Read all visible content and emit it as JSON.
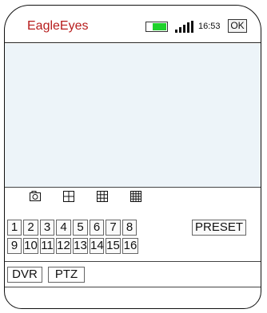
{
  "app": {
    "title": "EagleEyes"
  },
  "status": {
    "time": "16:53",
    "ok_label": "OK",
    "battery_level": 0.65,
    "battery_color": "#1fd12b",
    "title_color": "#b71c1c"
  },
  "layouts": [
    {
      "name": "snapshot-icon"
    },
    {
      "name": "quad-view-icon"
    },
    {
      "name": "nine-view-icon"
    },
    {
      "name": "sixteen-view-icon"
    }
  ],
  "channels": [
    "1",
    "2",
    "3",
    "4",
    "5",
    "6",
    "7",
    "8",
    "9",
    "10",
    "11",
    "12",
    "13",
    "14",
    "15",
    "16"
  ],
  "preset_label": "PRESET",
  "tabs": [
    {
      "label": "DVR"
    },
    {
      "label": "PTZ"
    }
  ]
}
